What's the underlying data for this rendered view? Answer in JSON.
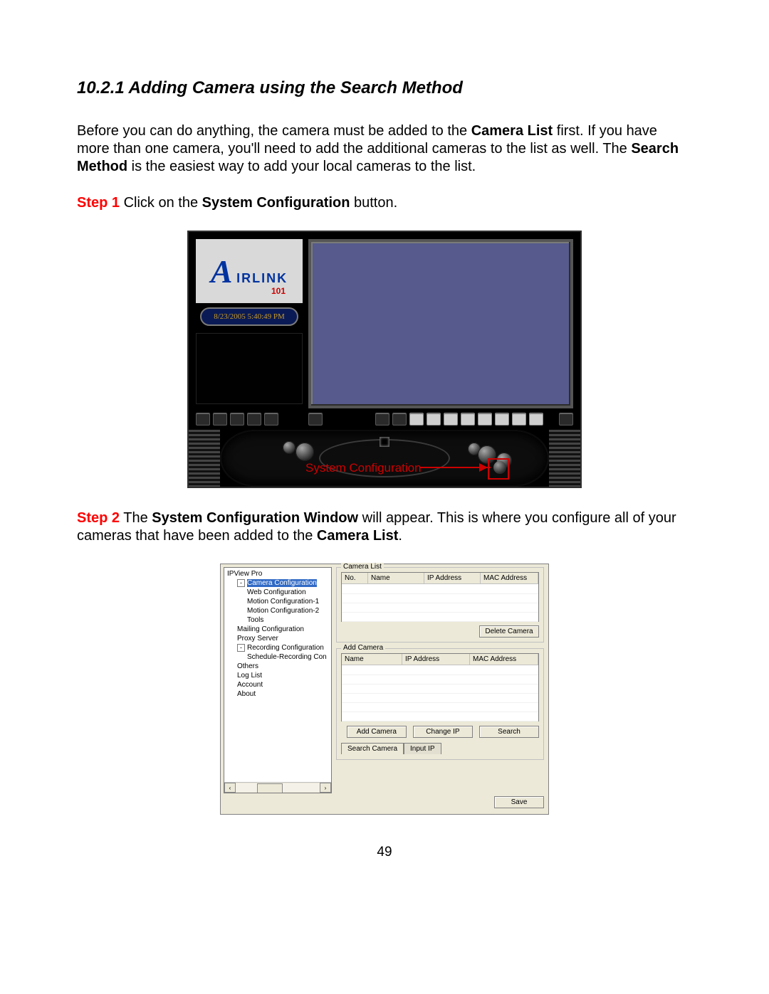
{
  "heading": "10.2.1 Adding Camera using the Search Method",
  "intro_parts": {
    "p1a": "Before you can do anything, the camera must be added to the ",
    "p1b": "Camera List",
    "p1c": " first. If you have more than one camera, you'll need to add the additional cameras to the list as well. The ",
    "p1d": "Search Method",
    "p1e": " is the easiest way to add your local cameras to the list."
  },
  "step1": {
    "label": "Step 1",
    "a": " Click on the ",
    "b": "System Configuration",
    "c": " button."
  },
  "app": {
    "brand_text": "IRLINK",
    "brand_sub": "101",
    "datetime": "8/23/2005 5:40:49 PM",
    "callout": "System Configuration"
  },
  "step2": {
    "label": "Step 2",
    "a": " The ",
    "b": "System Configuration Window",
    "c": " will appear. This is where you configure all of your cameras that have been added to the ",
    "d": "Camera List",
    "e": "."
  },
  "cfg": {
    "title": "IPView Pro",
    "tree": {
      "root": "Camera Configuration",
      "n1": "Web Configuration",
      "n2": "Motion Configuration-1",
      "n3": "Motion Configuration-2",
      "n4": "Tools",
      "n5": "Mailing Configuration",
      "n6": "Proxy Server",
      "n7": "Recording Configuration",
      "n8": "Schedule-Recording Con",
      "n9": "Others",
      "n10": "Log List",
      "n11": "Account",
      "n12": "About"
    },
    "camlist": {
      "legend": "Camera List",
      "h_no": "No.",
      "h_name": "Name",
      "h_ip": "IP Address",
      "h_mac": "MAC Address",
      "delete": "Delete Camera"
    },
    "addcam": {
      "legend": "Add Camera",
      "h_name": "Name",
      "h_ip": "IP Address",
      "h_mac": "MAC Address",
      "add": "Add Camera",
      "change": "Change IP",
      "search": "Search",
      "tab1": "Search Camera",
      "tab2": "Input IP"
    },
    "save": "Save"
  },
  "page_number": "49"
}
